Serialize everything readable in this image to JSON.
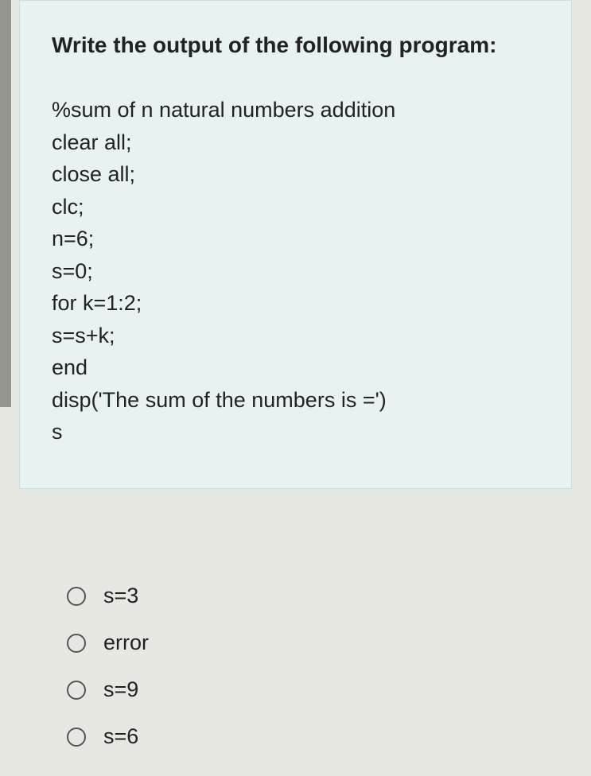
{
  "question": {
    "title": "Write the output of the following program:",
    "code": [
      "%sum of n natural numbers addition",
      "clear all;",
      "close all;",
      "clc;",
      "n=6;",
      "s=0;",
      "for k=1:2;",
      "s=s+k;",
      "end",
      "disp('The sum of the numbers is =')",
      "s"
    ]
  },
  "answers": [
    {
      "label": "s=3"
    },
    {
      "label": "error"
    },
    {
      "label": "s=9"
    },
    {
      "label": "s=6"
    }
  ]
}
